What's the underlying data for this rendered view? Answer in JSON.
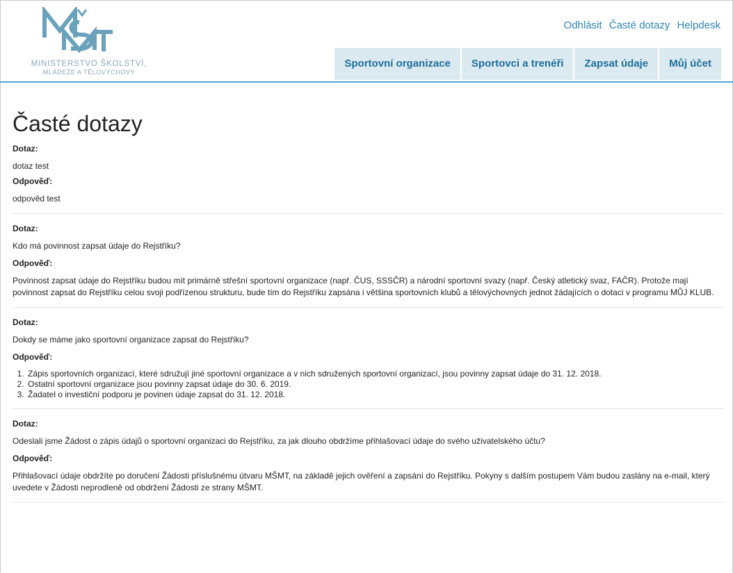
{
  "header": {
    "logo_line1": "MINISTERSTVO ŠKOLSTVÍ,",
    "logo_line2": "MLÁDEŽE A TĚLOVÝCHOVY",
    "top_links": [
      "Odhlásit",
      "Časté dotazy",
      "Helpdesk"
    ],
    "nav": [
      "Sportovní organizace",
      "Sportovci a trenéři",
      "Zapsat údaje",
      "Můj účet"
    ],
    "colors": {
      "accent": "#4aa7cc",
      "nav_bg": "#dbeaf0",
      "link": "#2e84b3",
      "logo": "#6aa2bc"
    }
  },
  "page_title": "Časté dotazy",
  "question_label": "Dotaz:",
  "answer_label": "Odpověď:",
  "faqs": [
    {
      "question": "dotaz test",
      "answer": "odpověd test"
    },
    {
      "question": "Kdo má povinnost zapsat údaje do Rejstříku?",
      "answer": "Povinnost zapsat údaje do Rejstříku budou mít primárně střešní sportovní organizace (např. ČUS, SSSČR) a národní sportovní svazy (např. Český atletický svaz, FAČR). Protože mají povinnost zapsat do Rejstříku celou svoji podřízenou strukturu, bude tím do Rejstříku zapsána i většina sportovních klubů a tělovýchovných jednot žádajících o dotaci v programu MŮJ KLUB."
    },
    {
      "question": "Dokdy se máme jako sportovní organizace zapsat do Rejstříku?",
      "answer_list": [
        "Zápis sportovních organizací, které sdružují jiné sportovní organizace a v nich sdružených sportovní organizací, jsou povinny zapsat údaje do 31. 12. 2018.",
        "Ostatní sportovní organizace jsou povinny zapsat údaje do 30. 6. 2019.",
        "Žadatel o investiční podporu je povinen údaje zapsat do 31. 12. 2018."
      ]
    },
    {
      "question": "Odeslali jsme Žádost o zápis údajů o sportovní organizaci do Rejstříku, za jak dlouho obdržíme přihlašovací údaje do svého uživatelského účtu?",
      "answer": "Přihlašovací údaje obdržíte po doručení Žádosti příslušnému útvaru MŠMT, na základě jejich ověření a zapsání do Rejstříku. Pokyny s dalším postupem Vám budou zaslány na e-mail, který uvedete v Žádosti neprodleně od obdržení Žádosti ze strany MŠMT."
    }
  ]
}
